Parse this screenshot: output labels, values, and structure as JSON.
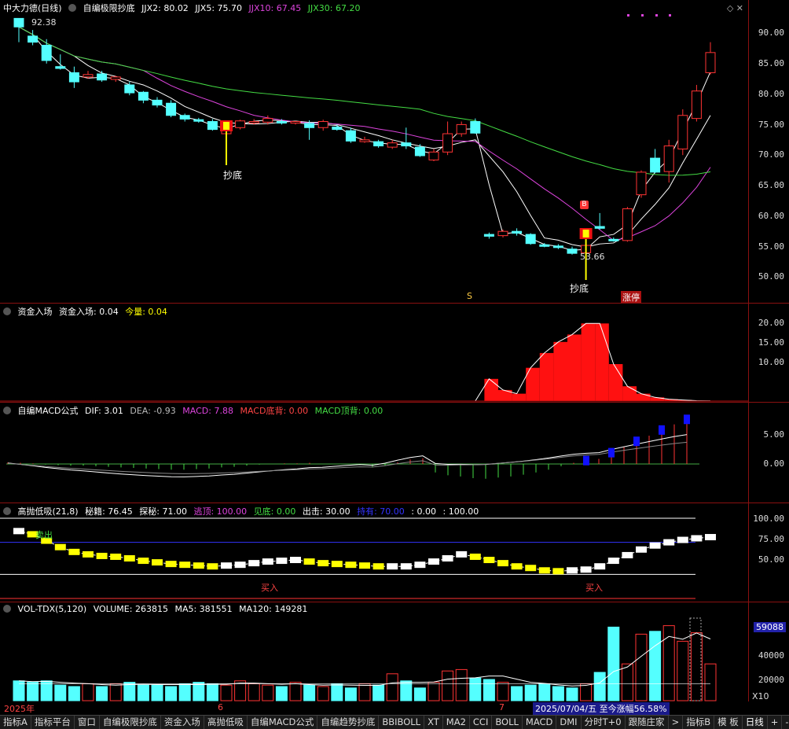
{
  "main": {
    "title": "中大力德(日线)",
    "indicator": "自编极限抄底",
    "readouts": [
      {
        "label": "JJX2: 80.02",
        "color": "#ffffff"
      },
      {
        "label": "JJX5: 75.70",
        "color": "#ffffff"
      },
      {
        "label": "JJX10: 67.45",
        "color": "#dd44dd"
      },
      {
        "label": "JJX30: 67.20",
        "color": "#44dd44"
      }
    ],
    "y_ticks": [
      "90.00",
      "85.00",
      "80.00",
      "75.00",
      "70.00",
      "65.00",
      "60.00",
      "55.00",
      "50.00"
    ],
    "hi_label": "92.38",
    "lo_label": "53.66",
    "buy_label_1": "抄底",
    "buy_label_2": "抄底",
    "b_badge": "B",
    "s_marker": "S",
    "zhangting": "涨停"
  },
  "fund": {
    "title": "资金入场",
    "readouts": [
      {
        "label": "资金入场: 0.04",
        "color": "#ffffff"
      },
      {
        "label": "今量: 0.04",
        "color": "#ffff00"
      }
    ],
    "y_ticks": [
      "20.00",
      "15.00",
      "10.00"
    ]
  },
  "macd": {
    "title": "自编MACD公式",
    "readouts": [
      {
        "label": "DIF: 3.01",
        "color": "#ffffff"
      },
      {
        "label": "DEA: -0.93",
        "color": "#bbbbbb"
      },
      {
        "label": "MACD: 7.88",
        "color": "#dd44dd"
      },
      {
        "label": "MACD底背: 0.00",
        "color": "#ff4444"
      },
      {
        "label": "MACD顶背: 0.00",
        "color": "#44dd44"
      }
    ],
    "y_ticks": [
      "5.00",
      "0.00"
    ]
  },
  "gaopao": {
    "title": "高抛低吸(21,8)",
    "readouts": [
      {
        "label": "秘籍: 76.45",
        "color": "#ffffff"
      },
      {
        "label": "探秘: 71.00",
        "color": "#ffffff"
      },
      {
        "label": "逃顶: 100.00",
        "color": "#dd44dd"
      },
      {
        "label": "见底: 0.00",
        "color": "#44dd44"
      },
      {
        "label": "出击: 30.00",
        "color": "#ffffff"
      },
      {
        "label": "持有: 70.00",
        "color": "#3333ff"
      },
      {
        "label": ": 0.00",
        "color": "#ffffff"
      },
      {
        "label": ": 100.00",
        "color": "#ffffff"
      }
    ],
    "y_ticks": [
      "100.00",
      "75.00",
      "50.00"
    ],
    "sell_label": "卖出",
    "buy_label_1": "买入",
    "buy_label_2": "买入"
  },
  "vol": {
    "title": "VOL-TDX(5,120)",
    "readouts": [
      {
        "label": "VOLUME: 263815",
        "color": "#ffffff"
      },
      {
        "label": "MA5: 381551",
        "color": "#ffffff"
      },
      {
        "label": "MA120: 149281",
        "color": "#ffffff"
      }
    ],
    "y_ticks": [
      "40000",
      "20000"
    ],
    "max_badge": "59088",
    "unit": "X10"
  },
  "datebar": {
    "start": "2025年",
    "m6": "6",
    "m7": "7",
    "status": "2025/07/04/五  至今涨幅56.58%"
  },
  "tabs": [
    "指标A",
    "指标平台",
    "窗口",
    "自编极限抄底",
    "资金入场",
    "高抛低吸",
    "自编MACD公式",
    "自编趋势抄底",
    "BBIBOLL",
    "XT",
    "MA2",
    "CCI",
    "BOLL",
    "MACD",
    "DMI",
    "分时T+0",
    "跟随庄家",
    ">",
    "指标B",
    "模 板",
    "日线",
    "+",
    "-"
  ],
  "colors": {
    "up": "#ff3333",
    "down": "#54ffff",
    "frame": "#8a1010"
  },
  "chart_data": {
    "type": "candlestick",
    "candles": [
      {
        "o": 92.4,
        "c": 91.0,
        "h": 92.4,
        "l": 88.5
      },
      {
        "o": 89.5,
        "c": 88.5,
        "h": 90.5,
        "l": 88.0
      },
      {
        "o": 88.0,
        "c": 85.5,
        "h": 89.0,
        "l": 85.0
      },
      {
        "o": 84.5,
        "c": 84.2,
        "h": 86.5,
        "l": 84.0
      },
      {
        "o": 83.5,
        "c": 82.0,
        "h": 84.5,
        "l": 81.0
      },
      {
        "o": 82.8,
        "c": 83.2,
        "h": 83.8,
        "l": 82.5
      },
      {
        "o": 83.3,
        "c": 82.3,
        "h": 83.8,
        "l": 82.0
      },
      {
        "o": 82.4,
        "c": 82.8,
        "h": 83.0,
        "l": 82.0
      },
      {
        "o": 81.5,
        "c": 80.2,
        "h": 82.0,
        "l": 79.8
      },
      {
        "o": 80.3,
        "c": 79.0,
        "h": 80.5,
        "l": 78.5
      },
      {
        "o": 79.0,
        "c": 78.2,
        "h": 79.5,
        "l": 77.8
      },
      {
        "o": 78.5,
        "c": 76.5,
        "h": 79.0,
        "l": 76.2
      },
      {
        "o": 76.5,
        "c": 75.9,
        "h": 76.8,
        "l": 75.5
      },
      {
        "o": 75.8,
        "c": 75.6,
        "h": 76.1,
        "l": 75.3
      },
      {
        "o": 75.5,
        "c": 74.2,
        "h": 75.9,
        "l": 74.0
      },
      {
        "o": 73.5,
        "c": 74.5,
        "h": 75.0,
        "l": 73.2
      },
      {
        "o": 74.5,
        "c": 75.6,
        "h": 75.8,
        "l": 74.2
      },
      {
        "o": 75.3,
        "c": 75.5,
        "h": 75.9,
        "l": 75.0
      },
      {
        "o": 75.4,
        "c": 76.0,
        "h": 76.5,
        "l": 75.0
      },
      {
        "o": 75.5,
        "c": 75.3,
        "h": 75.9,
        "l": 75.0
      },
      {
        "o": 75.3,
        "c": 75.5,
        "h": 75.6,
        "l": 75.0
      },
      {
        "o": 75.2,
        "c": 74.5,
        "h": 75.7,
        "l": 72.5
      },
      {
        "o": 74.5,
        "c": 75.5,
        "h": 75.8,
        "l": 74.0
      },
      {
        "o": 74.6,
        "c": 74.2,
        "h": 75.0,
        "l": 74.0
      },
      {
        "o": 74.0,
        "c": 72.3,
        "h": 74.5,
        "l": 72.0
      },
      {
        "o": 72.2,
        "c": 72.5,
        "h": 73.0,
        "l": 72.0
      },
      {
        "o": 72.2,
        "c": 71.5,
        "h": 72.5,
        "l": 71.2
      },
      {
        "o": 71.3,
        "c": 72.0,
        "h": 72.5,
        "l": 71.0
      },
      {
        "o": 72.0,
        "c": 71.5,
        "h": 74.5,
        "l": 71.0
      },
      {
        "o": 71.3,
        "c": 69.9,
        "h": 71.8,
        "l": 69.7
      },
      {
        "o": 69.2,
        "c": 70.5,
        "h": 71.0,
        "l": 69.0
      },
      {
        "o": 70.5,
        "c": 73.5,
        "h": 75.5,
        "l": 70.0
      },
      {
        "o": 73.5,
        "c": 75.0,
        "h": 75.5,
        "l": 73.0
      },
      {
        "o": 75.5,
        "c": 73.6,
        "h": 76.0,
        "l": 73.5
      },
      {
        "o": 57.0,
        "c": 56.7,
        "h": 57.3,
        "l": 56.3
      },
      {
        "o": 56.8,
        "c": 57.5,
        "h": 57.8,
        "l": 56.5
      },
      {
        "o": 57.5,
        "c": 57.2,
        "h": 58.0,
        "l": 56.8
      },
      {
        "o": 57.0,
        "c": 55.5,
        "h": 57.2,
        "l": 55.3
      },
      {
        "o": 55.3,
        "c": 55.2,
        "h": 55.6,
        "l": 54.9
      },
      {
        "o": 55.1,
        "c": 54.9,
        "h": 55.4,
        "l": 54.6
      },
      {
        "o": 54.6,
        "c": 53.9,
        "h": 55.0,
        "l": 53.7
      },
      {
        "o": 54.0,
        "c": 55.2,
        "h": 55.6,
        "l": 53.66
      },
      {
        "o": 58.3,
        "c": 58.0,
        "h": 60.5,
        "l": 57.8
      },
      {
        "o": 56.2,
        "c": 56.0,
        "h": 56.5,
        "l": 55.8
      },
      {
        "o": 56.0,
        "c": 61.2,
        "h": 61.5,
        "l": 55.8
      },
      {
        "o": 63.5,
        "c": 67.2,
        "h": 67.5,
        "l": 63.0
      },
      {
        "o": 69.5,
        "c": 67.2,
        "h": 71.0,
        "l": 67.0
      },
      {
        "o": 67.3,
        "c": 71.5,
        "h": 72.5,
        "l": 65.5
      },
      {
        "o": 71.0,
        "c": 76.5,
        "h": 77.5,
        "l": 70.0
      },
      {
        "o": 76.0,
        "c": 80.5,
        "h": 81.5,
        "l": 75.5
      },
      {
        "o": 83.5,
        "c": 86.8,
        "h": 88.5,
        "l": 83.2
      }
    ],
    "ylim": [
      48,
      93
    ],
    "fund_values": [
      0,
      0,
      0,
      0,
      0,
      0,
      0,
      0,
      0,
      0,
      0,
      0,
      0,
      0,
      0,
      0,
      0,
      0,
      0,
      0,
      0,
      0,
      0,
      0,
      0,
      0,
      0,
      0,
      0,
      0,
      0,
      0,
      0,
      0,
      6,
      3,
      2,
      9,
      13,
      16,
      18,
      21,
      21,
      10,
      4,
      2,
      1,
      0.5,
      0.3,
      0.1,
      0.04
    ],
    "macd_values": [
      0.3,
      0.2,
      0.1,
      -0.1,
      -0.2,
      -0.3,
      -0.3,
      -0.4,
      -0.5,
      -0.6,
      -0.7,
      -0.8,
      -0.9,
      -1.0,
      -1.0,
      -0.9,
      -0.8,
      -0.6,
      -0.5,
      -0.3,
      -0.1,
      0,
      0.1,
      0.1,
      0.2,
      0,
      0,
      0,
      -0.1,
      -0.6,
      -0.3,
      0.3,
      0.8,
      1.0,
      -1.5,
      -2.0,
      -2.2,
      -2.5,
      -2.6,
      -2.4,
      -2.2,
      -1.9,
      -1.5,
      -1.0,
      -0.4,
      0.2,
      0.6,
      0.9,
      2.0,
      3.0,
      4.0,
      5.0,
      6.0,
      7.0,
      7.88
    ],
    "gaopao_values": [
      84,
      80,
      72,
      64,
      58,
      55,
      53,
      52,
      50,
      47,
      45,
      43,
      42,
      41,
      40,
      41,
      42,
      44,
      46,
      47,
      48,
      46,
      44,
      43,
      42,
      41,
      40,
      40,
      40,
      42,
      46,
      50,
      55,
      52,
      48,
      44,
      40,
      38,
      35,
      34,
      35,
      36,
      40,
      47,
      54,
      61,
      66,
      70,
      73,
      75,
      76.45
    ],
    "vol_values": [
      14,
      13,
      14,
      11,
      10,
      12,
      10,
      12,
      13,
      11,
      11,
      10,
      12,
      13,
      12,
      11,
      14,
      12,
      11,
      10,
      13,
      11,
      10,
      12,
      9,
      12,
      11,
      19,
      14,
      9,
      13,
      21,
      22,
      16,
      15,
      13,
      10,
      11,
      12,
      10,
      9,
      12,
      20,
      52,
      26,
      47,
      49,
      53,
      42,
      48,
      26
    ]
  }
}
